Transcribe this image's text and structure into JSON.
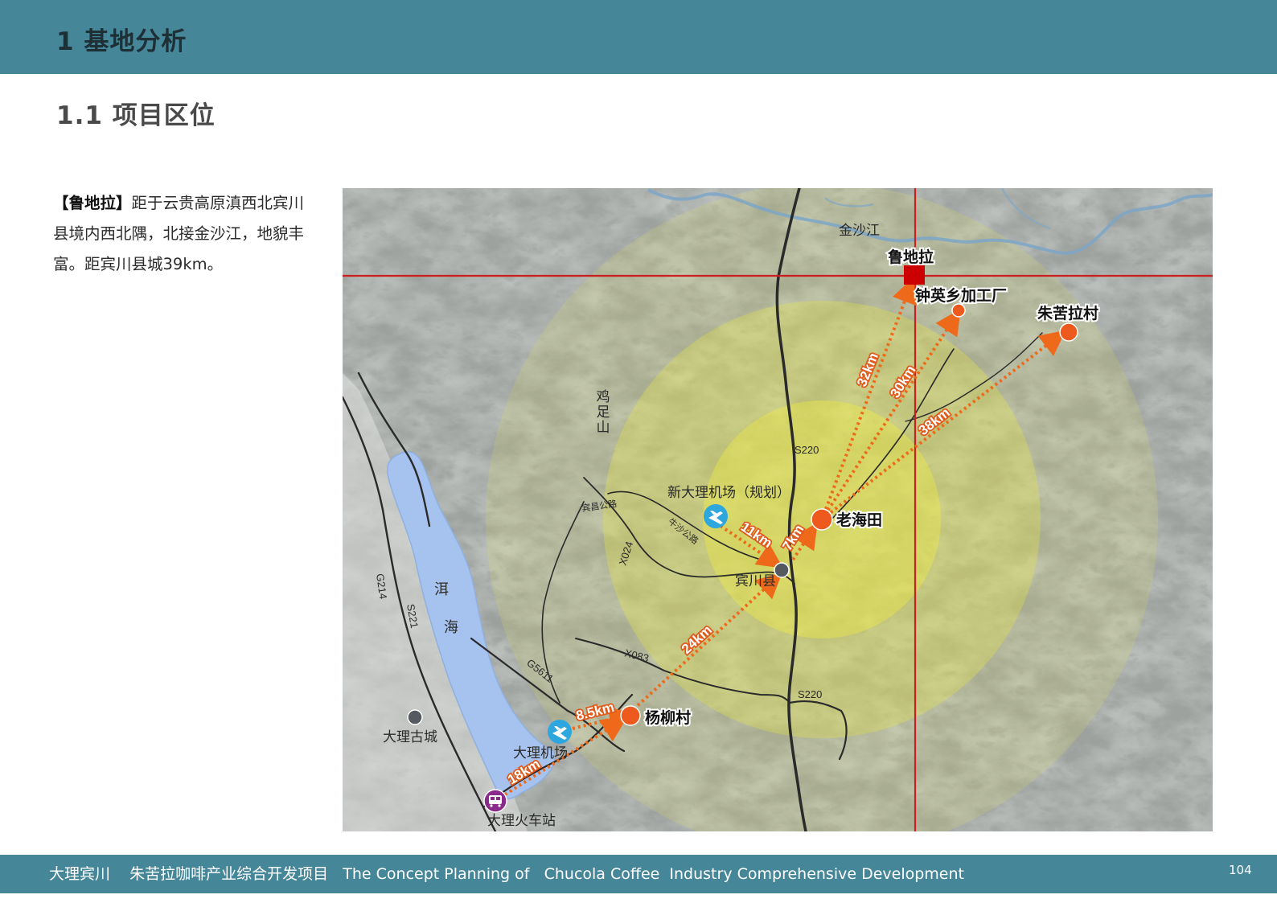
{
  "header": {
    "chapter_title": "1  基地分析",
    "section_title": "1.1  项目区位",
    "bar_color": "#458698"
  },
  "description": {
    "lead": "【鲁地拉】",
    "body": "距于云贵高原滇西北宾川县境内西北隅，北接金沙江，地貌丰富。距宾川县城39km。"
  },
  "map": {
    "places": {
      "ludila": "鲁地拉",
      "jinsha_river": "金沙江",
      "zhongying_factory": "钟英乡加工厂",
      "zhukula_village": "朱苦拉村",
      "laohaitian": "老海田",
      "binchuan_county": "宾川县",
      "new_dali_airport": "新大理机场（规划）",
      "yangliu_village": "杨柳村",
      "dali_airport": "大理机场",
      "dali_station": "大理火车站",
      "dali_old_town": "大理古城",
      "jizu_mountain": "鸡足山",
      "erhai_1": "洱",
      "erhai_2": "海"
    },
    "roads": {
      "s220_a": "S220",
      "s220_b": "S220",
      "x024": "X024",
      "x083": "X083",
      "g5611": "G5611",
      "g214": "G214",
      "s221": "S221",
      "binchang_road": "宾昌公路",
      "niusha_road": "牛沙公路"
    },
    "distances": {
      "d32": "32km",
      "d30": "30km",
      "d38": "38km",
      "d11": "11km",
      "d7": "7km",
      "d24": "24km",
      "d85": "8.5km",
      "d18": "18km"
    },
    "colors": {
      "marker_orange": "#ee5a1e",
      "route_arrow": "#ee6a1a",
      "crosshair": "#cc1f1f",
      "range_ring": "#e8e84a",
      "lake": "#a6c2ee",
      "airport_icon": "#2ea6de",
      "station_icon": "#8a2a8a",
      "county_marker": "#555a60"
    },
    "icons": {
      "airport": "airplane-icon",
      "station": "train-icon",
      "target": "square-marker-icon"
    }
  },
  "footer": {
    "text": "大理宾川    朱苦拉咖啡产业综合开发项目   The Concept Planning of   Chucola Coffee  Industry Comprehensive Development",
    "page_number": "104"
  }
}
